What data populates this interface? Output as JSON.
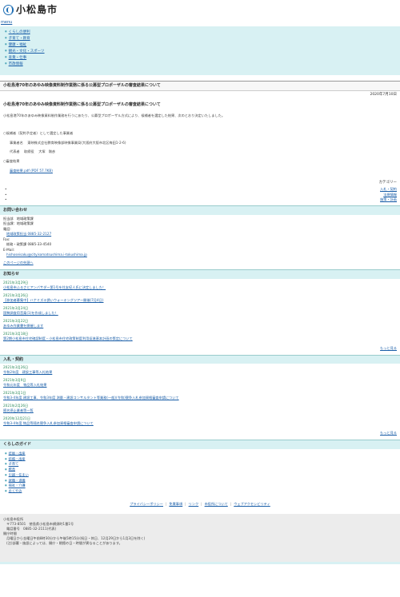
{
  "header": {
    "logo_text": "小松島市",
    "menu_label": "menu"
  },
  "nav": {
    "items": [
      "くらしの便利",
      "子育て・教育",
      "健康・福祉",
      "観光・文化・スポーツ",
      "産業・仕事",
      "市政情報"
    ]
  },
  "page": {
    "title": "小松島港70年のあゆみ映像資料制作業務に係る公募型プロポーザルの審査結果について",
    "date": "2020年7月10日",
    "heading": "小松島港70年のあゆみ映像資料制作業務に係る公募型プロポーザルの審査結果について",
    "intro": "小松島港70年のあゆみ映像資料制作業務を行うにあたり、公募型プロポーザル方式により、候補者を選定した結果、次のとおり決定いたしました。",
    "candidate_label": "○候補者（契約予定者）として選定した事業者",
    "company_label": "事業者名",
    "company_name": "東映株式会社教育映像部映像事業局(大阪府大阪市北区梅田1-2-6)",
    "rep_label": "代表者",
    "rep_title": "取締役",
    "rep_name": "大塚　剛彦",
    "results_label": "○審査結果",
    "results_link": "審査結果.pdf (PDF 57.7KB)"
  },
  "category": {
    "title": "カテゴリー",
    "items": [
      "入札・契約",
      "法規情報",
      "施策・計画"
    ]
  },
  "contact": {
    "title": "お問い合わせ",
    "dept": "担当部　地域政策課",
    "section": "担当課：地域政策課",
    "phone_label": "電話:",
    "phone": "地域政策担当 0885-32-2127",
    "fax_label": "Fax:",
    "fax": "総務・政策課 0885-33-4540",
    "email_label": "E-Mail:",
    "email": "hishoseisaku@city.komatsushima.i-tokushima.jp",
    "survey": "このページの先頭へ"
  },
  "news": {
    "title": "お知らせ",
    "items": [
      {
        "date": "2021年3月29日",
        "text": "小松島市ふるさとアンバサダー第1号を住友紀人氏に決定しました！"
      },
      {
        "date": "2021年3月26日",
        "text": "【参加者募集中】ハナミズキ誘いウォーキングツアー開催(7月4日)"
      },
      {
        "date": "2021年3月24日",
        "text": "国勢調査用音楽(1)を作成しました！"
      },
      {
        "date": "2021年3月22日",
        "text": "あゆみ作業書を開催します"
      },
      {
        "date": "2021年3月18日",
        "text": "第2期小松島市住宅確認制度・小松島市住宅政策制度利用促進基本計画の策定について"
      }
    ],
    "more": "もっと見る"
  },
  "bids": {
    "title": "入札・契約",
    "items": [
      {
        "date": "2021年3月26日",
        "text": "令和2年度　建設工事等入札結果"
      },
      {
        "date": "2021年3月9日",
        "text": "令和元年度　物品等入札結果"
      },
      {
        "date": "2021年3月1日",
        "text": "令和3-4年度 建設工事、令和3年度 測量・建設コンサルタント等業務(一般)(令和)競争入札参加資格審査申請について"
      },
      {
        "date": "2021年2月26日",
        "text": "随名停止業者等一覧"
      },
      {
        "date": "2020年12月21日",
        "text": "令和3-4年度 物品等随名競争入札参加資格審査申請について"
      }
    ],
    "more": "もっと見る"
  },
  "guide": {
    "title": "くらしのガイド",
    "items": [
      "妊娠・出産",
      "結婚・出産",
      "子育て",
      "教育",
      "引越・住まい",
      "就職・退職",
      "福祉・介護",
      "おくやみ"
    ]
  },
  "footer_links": [
    "プライバシーポリシー",
    "免責事項",
    "リンク",
    "市役所について",
    "ウェブアクセシビリティ"
  ],
  "footer": {
    "name": "小松島市役所",
    "address": "〒773-8501　徳島県小松島市横須町1番1号",
    "phone": "電話番号　0885-32-2111(代表)",
    "hours_label": "開庁時間",
    "hours": "月曜日から金曜日午前8時30分から午後5時15分(祝日・休日、12月29日から1月3日を除く)",
    "note": "(注)部署・施設によっては、開庁・閉館の日・時間が異なることがあります。"
  }
}
